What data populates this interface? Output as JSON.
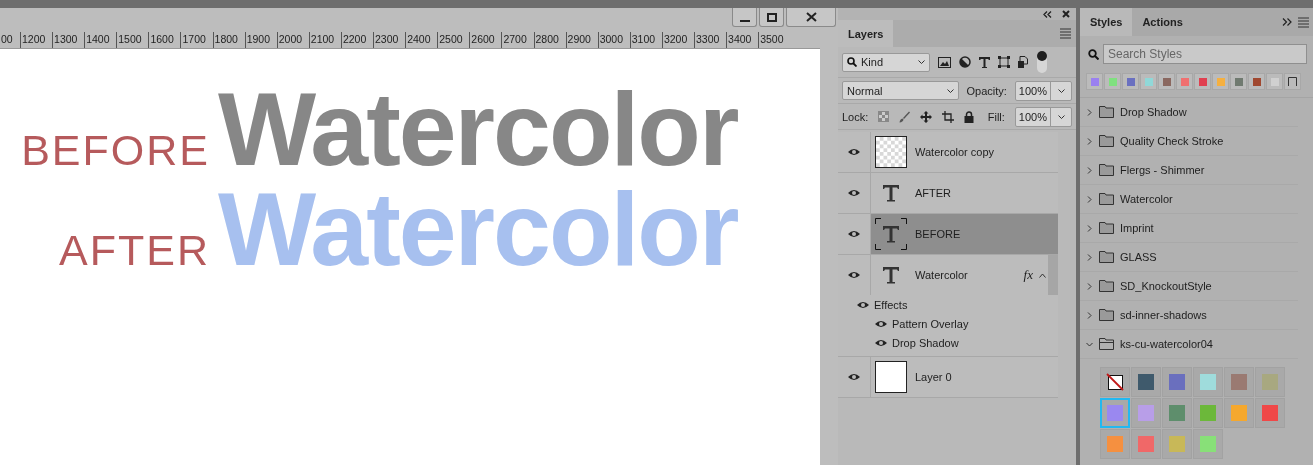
{
  "ruler": {
    "labels": [
      "00",
      "1200",
      "1300",
      "1400",
      "1500",
      "1600",
      "1700",
      "1800",
      "1900",
      "2000",
      "2100",
      "2200",
      "2300",
      "2400",
      "2500",
      "2600",
      "2700",
      "2800",
      "2900",
      "3000",
      "3100",
      "3200",
      "3300",
      "3400",
      "3500"
    ]
  },
  "canvas": {
    "lines": [
      {
        "label": "BEFORE",
        "word": "Watercolor",
        "kind": "plain"
      },
      {
        "label": "AFTER",
        "word": "Watercolor",
        "kind": "watercolor"
      }
    ]
  },
  "layers_panel": {
    "tab": "Layers",
    "filter": {
      "value": "Kind",
      "enabled": true
    },
    "blend_mode": "Normal",
    "opacity_label": "Opacity:",
    "opacity": "100%",
    "lock_label": "Lock:",
    "fill_label": "Fill:",
    "fill": "100%",
    "layers": [
      {
        "name": "Watercolor copy",
        "kind": "pixel",
        "visible": true,
        "selected": false
      },
      {
        "name": "AFTER",
        "kind": "text",
        "visible": true,
        "selected": false
      },
      {
        "name": "BEFORE",
        "kind": "text",
        "visible": true,
        "selected": true
      },
      {
        "name": "Watercolor",
        "kind": "text",
        "visible": true,
        "selected": false,
        "fx": "fx",
        "expanded": true,
        "effects_label": "Effects",
        "effects_visible": true,
        "effects": [
          {
            "name": "Pattern Overlay",
            "visible": true
          },
          {
            "name": "Drop Shadow",
            "visible": true
          }
        ]
      },
      {
        "name": "Layer 0",
        "kind": "fill",
        "visible": true,
        "selected": false
      }
    ]
  },
  "styles_panel": {
    "tabs": [
      {
        "label": "Styles",
        "selected": true
      },
      {
        "label": "Actions",
        "selected": false
      }
    ],
    "search": {
      "placeholder": "Search Styles"
    },
    "recent": [
      {
        "kind": "style",
        "color": "#9a80f0"
      },
      {
        "kind": "style",
        "color": "#80e080"
      },
      {
        "kind": "style",
        "color": "#6a70c0"
      },
      {
        "kind": "style",
        "color": "#90d8d8"
      },
      {
        "kind": "style",
        "color": "#8a6860"
      },
      {
        "kind": "style",
        "color": "#f07070"
      },
      {
        "kind": "style",
        "color": "#e04050"
      },
      {
        "kind": "style",
        "color": "#f5b040"
      },
      {
        "kind": "style",
        "color": "#707a70"
      },
      {
        "kind": "style",
        "color": "#a04830"
      },
      {
        "kind": "style",
        "color": "#d0d0d0"
      },
      {
        "kind": "outline"
      }
    ],
    "groups": [
      {
        "name": "Drop Shadow",
        "expanded": false
      },
      {
        "name": "Quality Check Stroke",
        "expanded": false
      },
      {
        "name": "Flergs - Shimmer",
        "expanded": false
      },
      {
        "name": "Watercolor",
        "expanded": false
      },
      {
        "name": "Imprint",
        "expanded": false
      },
      {
        "name": "GLASS",
        "expanded": false
      },
      {
        "name": "SD_KnockoutStyle",
        "expanded": false
      },
      {
        "name": "sd-inner-shadows",
        "expanded": false
      },
      {
        "name": "ks-cu-watercolor04",
        "expanded": true
      }
    ],
    "swatches": [
      {
        "kind": "none",
        "selected": false
      },
      {
        "kind": "style",
        "color": "#3f5a6c",
        "selected": false
      },
      {
        "kind": "style",
        "color": "#6a6fbe",
        "selected": false
      },
      {
        "kind": "style",
        "color": "#9fdcdc",
        "selected": false
      },
      {
        "kind": "style",
        "color": "#9a7a72",
        "selected": false
      },
      {
        "kind": "style",
        "color": "#a8a880",
        "selected": false
      },
      {
        "kind": "style",
        "color": "#9a88f0",
        "selected": true
      },
      {
        "kind": "style",
        "color": "#b89ee8",
        "selected": false
      },
      {
        "kind": "style",
        "color": "#5e8e6c",
        "selected": false
      },
      {
        "kind": "style",
        "color": "#6cb83a",
        "selected": false
      },
      {
        "kind": "style",
        "color": "#f5a82e",
        "selected": false
      },
      {
        "kind": "style",
        "color": "#f04848",
        "selected": false
      },
      {
        "kind": "style",
        "color": "#f59040",
        "selected": false
      },
      {
        "kind": "style",
        "color": "#f06868",
        "selected": false
      },
      {
        "kind": "style",
        "color": "#c8b858",
        "selected": false
      },
      {
        "kind": "style",
        "color": "#88e078",
        "selected": false
      }
    ]
  }
}
